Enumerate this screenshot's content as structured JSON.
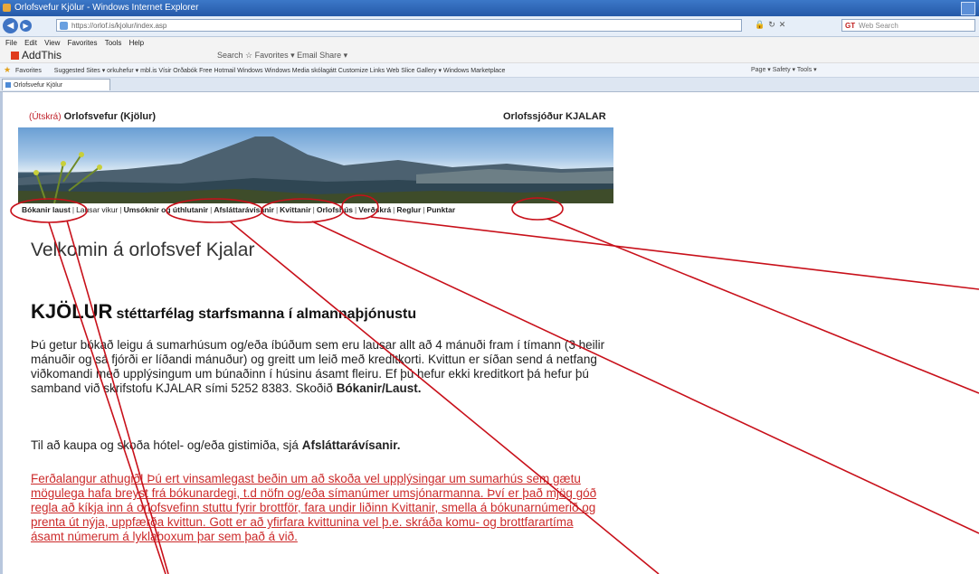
{
  "browser": {
    "window_title": "Orlofsvefur Kjölur - Windows Internet Explorer",
    "address": "https://orlof.is/kjolur/index.asp",
    "search_placeholder": "Web Search",
    "search_brand": "GT",
    "menu": [
      "File",
      "Edit",
      "View",
      "Favorites",
      "Tools",
      "Help"
    ],
    "addthis_label": "AddThis",
    "addthis_tools": "Search  ☆ Favorites ▾  Email  Share ▾",
    "favorites_label": "Favorites",
    "favorites_items": "Suggested Sites ▾   orkuhefur ▾   mbl.is   Vísir   Orðabók   Free Hotmail   Windows   Windows Media   skólagátt   Customize Links   Web Slice Gallery ▾   Windows Marketplace",
    "command_bar": "Page ▾  Safety ▾  Tools ▾",
    "tab_label": "Orlofsvefur Kjölur"
  },
  "page": {
    "login_link": "(Útskrá)",
    "site_title": "Orlofsvefur (Kjölur)",
    "org_name": "Orlofssjóður KJALAR",
    "nav": [
      {
        "label": "Bókanir laust",
        "bold": true
      },
      {
        "label": "Lausar vikur",
        "bold": false
      },
      {
        "label": "Umsóknir og úthlutanir",
        "bold": true
      },
      {
        "label": "Afsláttarávísanir",
        "bold": true
      },
      {
        "label": "Kvittanir",
        "bold": true
      },
      {
        "label": "Orlofshús",
        "bold": true
      },
      {
        "label": "Verðskrá",
        "bold": true
      },
      {
        "label": "Reglur",
        "bold": true
      },
      {
        "label": "Punktar",
        "bold": true
      }
    ],
    "welcome": "Velkomin á orlofsvef Kjalar",
    "union_name": "KJÖLUR",
    "union_subtitle": "stéttarfélag starfsmanna í almannaþjónustu",
    "p1_text": "Þú getur bókað leigu á sumarhúsum og/eða íbúðum sem eru lausar allt að 4 mánuði fram í tímann (3 heilir mánuðir og sá fjórði er líðandi mánuður) og greitt um leið með kreditkorti. Kvittun er síðan send á netfang viðkomandi með upplýsingum um búnaðinn í húsinu ásamt fleiru. Ef þú hefur ekki kreditkort þá hefur þú samband við skrifstofu KJALAR sími 5252 8383. Skoðið",
    "p1_bold": "Bókanir/Laust.",
    "p2_text": "Til að kaupa og skoða hótel- og/eða gistimiða, sjá",
    "p2_bold": "Afsláttarávísanir.",
    "warning": "Ferðalangur athugið! Þú ert vinsamlegast beðin um að skoða vel upplýsingar um sumarhús sem gætu mögulega hafa breyst frá bókunardegi, t.d nöfn og/eða símanúmer umsjónarmanna. Því er það mjög góð regla að kíkja inn á orlofsvefinn stuttu fyrir brottför, fara undir liðinn Kvittanir, smella á bókunarnúmerið og prenta út nýja, uppfærða kvittun. Gott er að yfirfara kvittunina vel þ.e. skráða komu- og brottfarartíma ásamt númerum á lyklaboxum þar sem það á við."
  },
  "colors": {
    "annotation": "#c8101a",
    "warning_text": "#cc2b2b",
    "ie_blue": "#2f66b5"
  },
  "icons": [
    "ie-icon",
    "back-icon",
    "forward-icon",
    "lock-icon",
    "refresh-icon",
    "stop-icon",
    "favorites-star-icon",
    "addthis-icon",
    "page-icon"
  ]
}
